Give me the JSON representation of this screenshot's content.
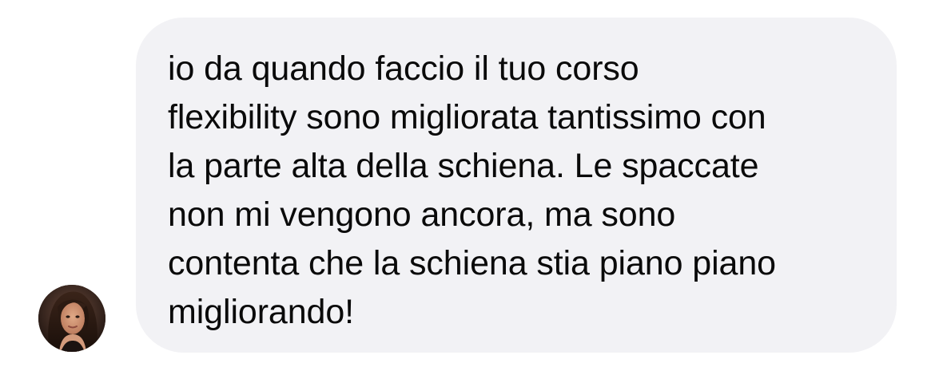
{
  "conversation": {
    "message": {
      "text": "io da quando faccio il tuo corso\nflexibility sono migliorata tantissimo con\nla parte alta della schiena. Le spaccate\nnon mi vengono ancora, ma sono\ncontenta che la schiena stia piano piano\nmigliorando!"
    },
    "avatar": {
      "description_icon": "user-avatar-photo"
    }
  },
  "colors": {
    "bubble_background": "#f2f2f5",
    "text": "#0a0a0a",
    "page_background": "#ffffff"
  }
}
